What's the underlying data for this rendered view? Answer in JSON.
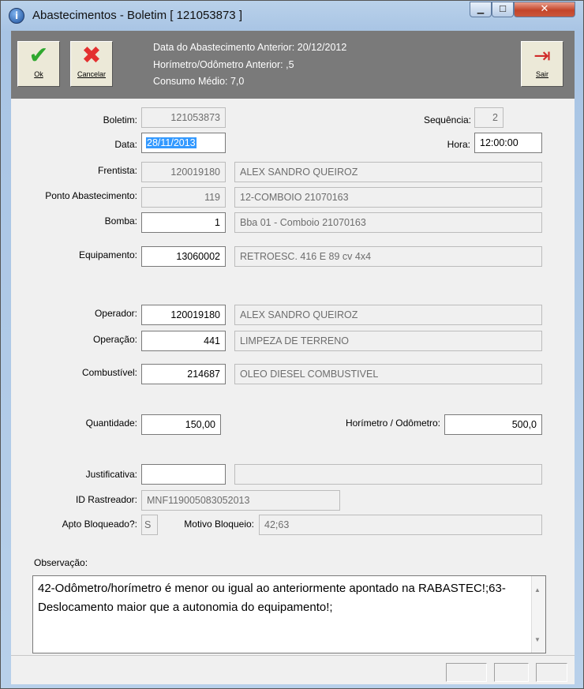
{
  "window": {
    "title": "Abastecimentos - Boletim [ 121053873 ]",
    "icon": "app-info-icon",
    "controls": {
      "minimize": "minimize-icon",
      "maximize": "maximize-icon",
      "close": "close-icon"
    }
  },
  "toolbar": {
    "ok_label": "Ok",
    "cancel_label": "Cancelar",
    "exit_label": "Sair",
    "info": {
      "previous_date": "Data do Abastecimento Anterior: 20/12/2012",
      "previous_meter": "Horímetro/Odômetro Anterior: ,5",
      "average_consumption": "Consumo Médio: 7,0"
    }
  },
  "form": {
    "boletim": {
      "label": "Boletim:",
      "value": "121053873"
    },
    "sequencia": {
      "label": "Sequência:",
      "value": "2"
    },
    "data": {
      "label": "Data:",
      "value": "28/11/2013"
    },
    "hora": {
      "label": "Hora:",
      "value": "12:00:00"
    },
    "frentista": {
      "label": "Frentista:",
      "code": "120019180",
      "name": "ALEX SANDRO QUEIROZ"
    },
    "ponto": {
      "label": "Ponto Abastecimento:",
      "code": "119",
      "name": "12-COMBOIO 21070163"
    },
    "bomba": {
      "label": "Bomba:",
      "code": "1",
      "name": "Bba 01 - Comboio 21070163"
    },
    "equipamento": {
      "label": "Equipamento:",
      "code": "13060002",
      "name": "RETROESC. 416 E 89 cv 4x4"
    },
    "operador": {
      "label": "Operador:",
      "code": "120019180",
      "name": "ALEX SANDRO QUEIROZ"
    },
    "operacao": {
      "label": "Operação:",
      "code": "441",
      "name": "LIMPEZA DE TERRENO"
    },
    "combustivel": {
      "label": "Combustível:",
      "code": "214687",
      "name": "OLEO DIESEL COMBUSTIVEL"
    },
    "quantidade": {
      "label": "Quantidade:",
      "value": "150,00"
    },
    "horimetro": {
      "label": "Horímetro / Odômetro:",
      "value": "500,0"
    },
    "justificativa": {
      "label": "Justificativa:",
      "code": "",
      "name": ""
    },
    "rastreador": {
      "label": "ID Rastreador:",
      "value": "MNF119005083052013"
    },
    "apto": {
      "label": "Apto Bloqueado?:",
      "value": "S"
    },
    "motivo": {
      "label": "Motivo Bloqueio:",
      "value": "42;63"
    },
    "observacao": {
      "label": "Observação:",
      "text": "42-Odômetro/horímetro é menor ou igual ao anteriormente apontado na RABASTEC!;63-Deslocamento maior que a autonomia do equipamento!;"
    }
  }
}
